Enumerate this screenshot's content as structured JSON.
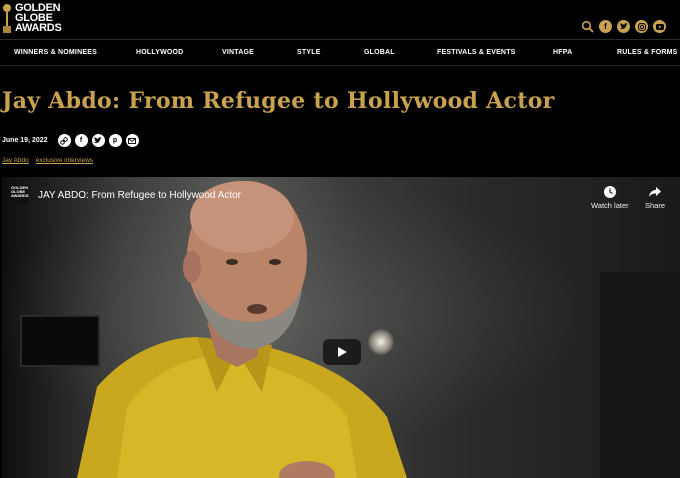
{
  "header": {
    "logo": {
      "line1": "GOLDEN",
      "line2": "GLOBE",
      "line3": "AWARDS"
    },
    "icons": [
      "search-icon",
      "facebook-icon",
      "twitter-icon",
      "instagram-icon",
      "youtube-icon"
    ]
  },
  "nav": {
    "items": [
      {
        "label": "WINNERS & NOMINEES"
      },
      {
        "label": "HOLLYWOOD"
      },
      {
        "label": "VINTAGE"
      },
      {
        "label": "STYLE"
      },
      {
        "label": "GLOBAL"
      },
      {
        "label": "FESTIVALS & EVENTS"
      },
      {
        "label": "HFPA"
      },
      {
        "label": "RULES & FORMS"
      }
    ]
  },
  "article": {
    "title": "Jay Abdo: From Refugee to Hollywood Actor",
    "date": "June 19, 2022",
    "share_icons": [
      "link-icon",
      "facebook-icon",
      "twitter-icon",
      "pinterest-icon",
      "email-icon"
    ],
    "tags": [
      "Jay Abdo",
      "exclusive interviews"
    ]
  },
  "video": {
    "title": "JAY ABDO: From Refugee to Hollywood Actor",
    "channel_logo": {
      "line1": "GOLDEN",
      "line2": "GLOBE",
      "line3": "AWARDS"
    },
    "watch_later": "Watch later",
    "share": "Share"
  },
  "colors": {
    "accent": "#c9a24d",
    "background": "#000000"
  }
}
